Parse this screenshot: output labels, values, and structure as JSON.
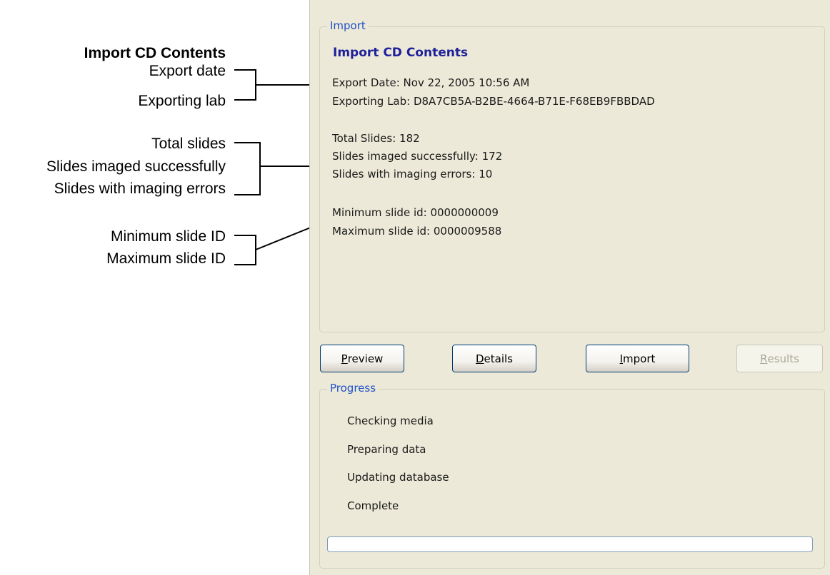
{
  "annotations": {
    "title": "Import CD Contents",
    "export_date": "Export date",
    "exporting_lab": "Exporting lab",
    "total_slides": "Total slides",
    "slides_success": "Slides imaged successfully",
    "slides_errors": "Slides with imaging errors",
    "min_id": "Minimum slide ID",
    "max_id": "Maximum slide ID"
  },
  "import_group": {
    "legend": "Import",
    "heading": "Import CD Contents",
    "export_date": "Export Date: Nov 22, 2005 10:56 AM",
    "exporting_lab": "Exporting Lab: D8A7CB5A-B2BE-4664-B71E-F68EB9FBBDAD",
    "total_slides": "Total Slides: 182",
    "slides_success": "Slides imaged successfully: 172",
    "slides_errors": "Slides with imaging errors: 10",
    "min_id": "Minimum slide id: 0000000009",
    "max_id": "Maximum slide id: 0000009588"
  },
  "buttons": {
    "preview": {
      "accel": "P",
      "rest": "review"
    },
    "details": {
      "accel": "D",
      "rest": "etails"
    },
    "import": {
      "accel": "I",
      "rest": "mport"
    },
    "results": {
      "accel": "R",
      "rest": "esults",
      "enabled": false
    }
  },
  "progress_group": {
    "legend": "Progress",
    "steps": [
      "Checking media",
      "Preparing data",
      "Updating database",
      "Complete"
    ],
    "progress_value": 0
  },
  "colors": {
    "panel_bg": "#ece9d8",
    "legend_text": "#2150c8",
    "heading_text": "#1f1f9a",
    "button_border": "#003c74",
    "progress_border": "#7f9db9"
  }
}
